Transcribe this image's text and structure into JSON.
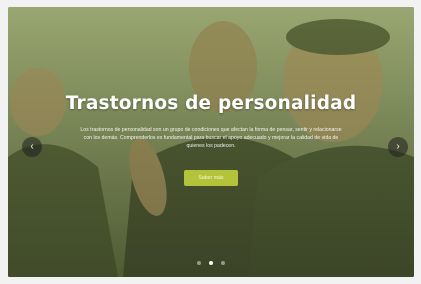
{
  "slider": {
    "title": "Trastornos de personalidad",
    "description": "Los trastornos de personalidad son un grupo de condiciones que afectan la forma de pensar, sentir y relacionarse con los demás. Comprenderlos es fundamental para buscar el apoyo adecuado y mejorar la calidad de vida de quienes los padecen.",
    "cta_label": "Saber más",
    "prev_symbol": "‹",
    "next_symbol": "›",
    "dots": [
      false,
      true,
      false
    ],
    "accent_color": "#b4c43a"
  }
}
